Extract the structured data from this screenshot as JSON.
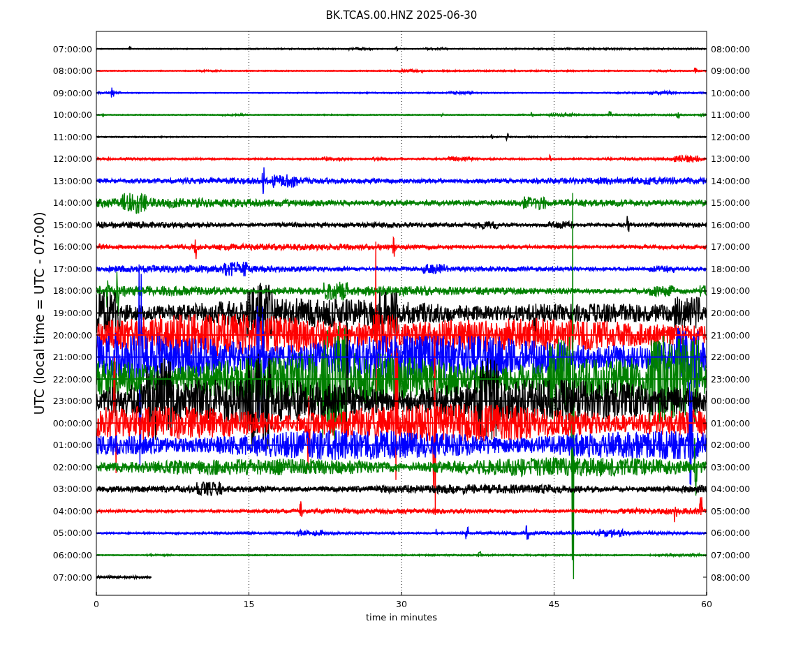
{
  "title": "BK.TCAS.00.HNZ 2025-06-30",
  "ylabel": "UTC (local time = UTC - 07:00)",
  "xlabel": "time in minutes",
  "xticks": [
    "0",
    "15",
    "30",
    "45",
    "60"
  ],
  "rows": [
    {
      "left": "07:00:00",
      "right": "08:00:00",
      "color": "#000000",
      "level": 1
    },
    {
      "left": "08:00:00",
      "right": "09:00:00",
      "color": "#ff0000",
      "level": 1
    },
    {
      "left": "09:00:00",
      "right": "10:00:00",
      "color": "#0000ff",
      "level": 1
    },
    {
      "left": "10:00:00",
      "right": "11:00:00",
      "color": "#008000",
      "level": 1
    },
    {
      "left": "11:00:00",
      "right": "12:00:00",
      "color": "#000000",
      "level": 1
    },
    {
      "left": "12:00:00",
      "right": "13:00:00",
      "color": "#ff0000",
      "level": 1
    },
    {
      "left": "13:00:00",
      "right": "14:00:00",
      "color": "#0000ff",
      "level": 1
    },
    {
      "left": "14:00:00",
      "right": "15:00:00",
      "color": "#008000",
      "level": 1
    },
    {
      "left": "15:00:00",
      "right": "16:00:00",
      "color": "#000000",
      "level": 1
    },
    {
      "left": "16:00:00",
      "right": "17:00:00",
      "color": "#ff0000",
      "level": 1
    },
    {
      "left": "17:00:00",
      "right": "18:00:00",
      "color": "#0000ff",
      "level": 1
    },
    {
      "left": "18:00:00",
      "right": "19:00:00",
      "color": "#008000",
      "level": 1
    },
    {
      "left": "19:00:00",
      "right": "20:00:00",
      "color": "#000000",
      "level": 1
    },
    {
      "left": "20:00:00",
      "right": "21:00:00",
      "color": "#ff0000",
      "level": 1
    },
    {
      "left": "21:00:00",
      "right": "22:00:00",
      "color": "#0000ff",
      "level": 1
    },
    {
      "left": "22:00:00",
      "right": "23:00:00",
      "color": "#008000",
      "level": 1
    },
    {
      "left": "23:00:00",
      "right": "00:00:00",
      "color": "#000000",
      "level": 1
    },
    {
      "left": "00:00:00",
      "right": "01:00:00",
      "color": "#ff0000",
      "level": 1
    },
    {
      "left": "01:00:00",
      "right": "02:00:00",
      "color": "#0000ff",
      "level": 1
    },
    {
      "left": "02:00:00",
      "right": "03:00:00",
      "color": "#008000",
      "level": 1
    },
    {
      "left": "03:00:00",
      "right": "04:00:00",
      "color": "#000000",
      "level": 1
    },
    {
      "left": "04:00:00",
      "right": "05:00:00",
      "color": "#ff0000",
      "level": 1
    },
    {
      "left": "05:00:00",
      "right": "06:00:00",
      "color": "#0000ff",
      "level": 1
    },
    {
      "left": "06:00:00",
      "right": "07:00:00",
      "color": "#008000",
      "level": 1
    },
    {
      "left": "07:00:00",
      "right": "08:00:00",
      "color": "#000000",
      "level": 0.09
    }
  ]
}
